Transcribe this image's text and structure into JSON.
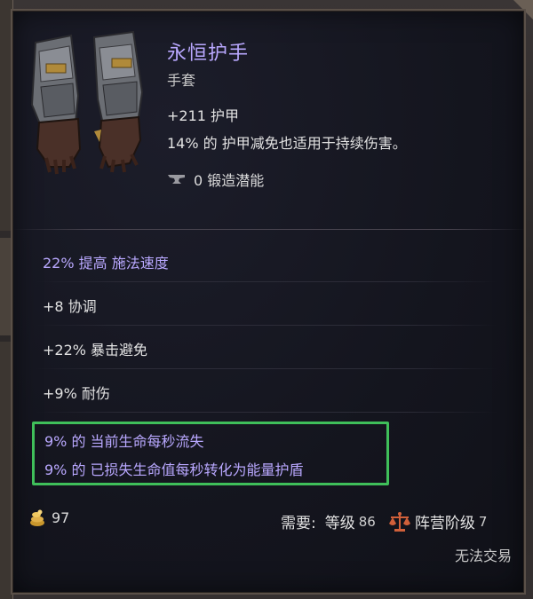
{
  "item": {
    "name": "永恒护手",
    "type": "手套",
    "armor_line": "+211 护甲",
    "armor_effect": "14% 的 护甲减免也适用于持续伤害。",
    "forge_potential": "0 锻造潜能",
    "image_icon": "gauntlets-icon"
  },
  "affixes": {
    "implicit": "22% 提高 施法速度",
    "list": [
      "+8 协调",
      "+22% 暴击避免",
      "+9% 耐伤"
    ]
  },
  "special_mods": [
    "9% 的 当前生命每秒流失",
    "9% 的 已损失生命值每秒转化为能量护盾"
  ],
  "footer": {
    "gold_value": "97",
    "requirement_label": "需要:",
    "level_label": "等级",
    "level_value": "86",
    "faction_label": "阵营阶级",
    "faction_value": "7",
    "trade_status": "无法交易"
  },
  "colors": {
    "title": "#b9a8ff",
    "highlight_border": "#3fbf5a",
    "panel_bg": "#14151e"
  }
}
